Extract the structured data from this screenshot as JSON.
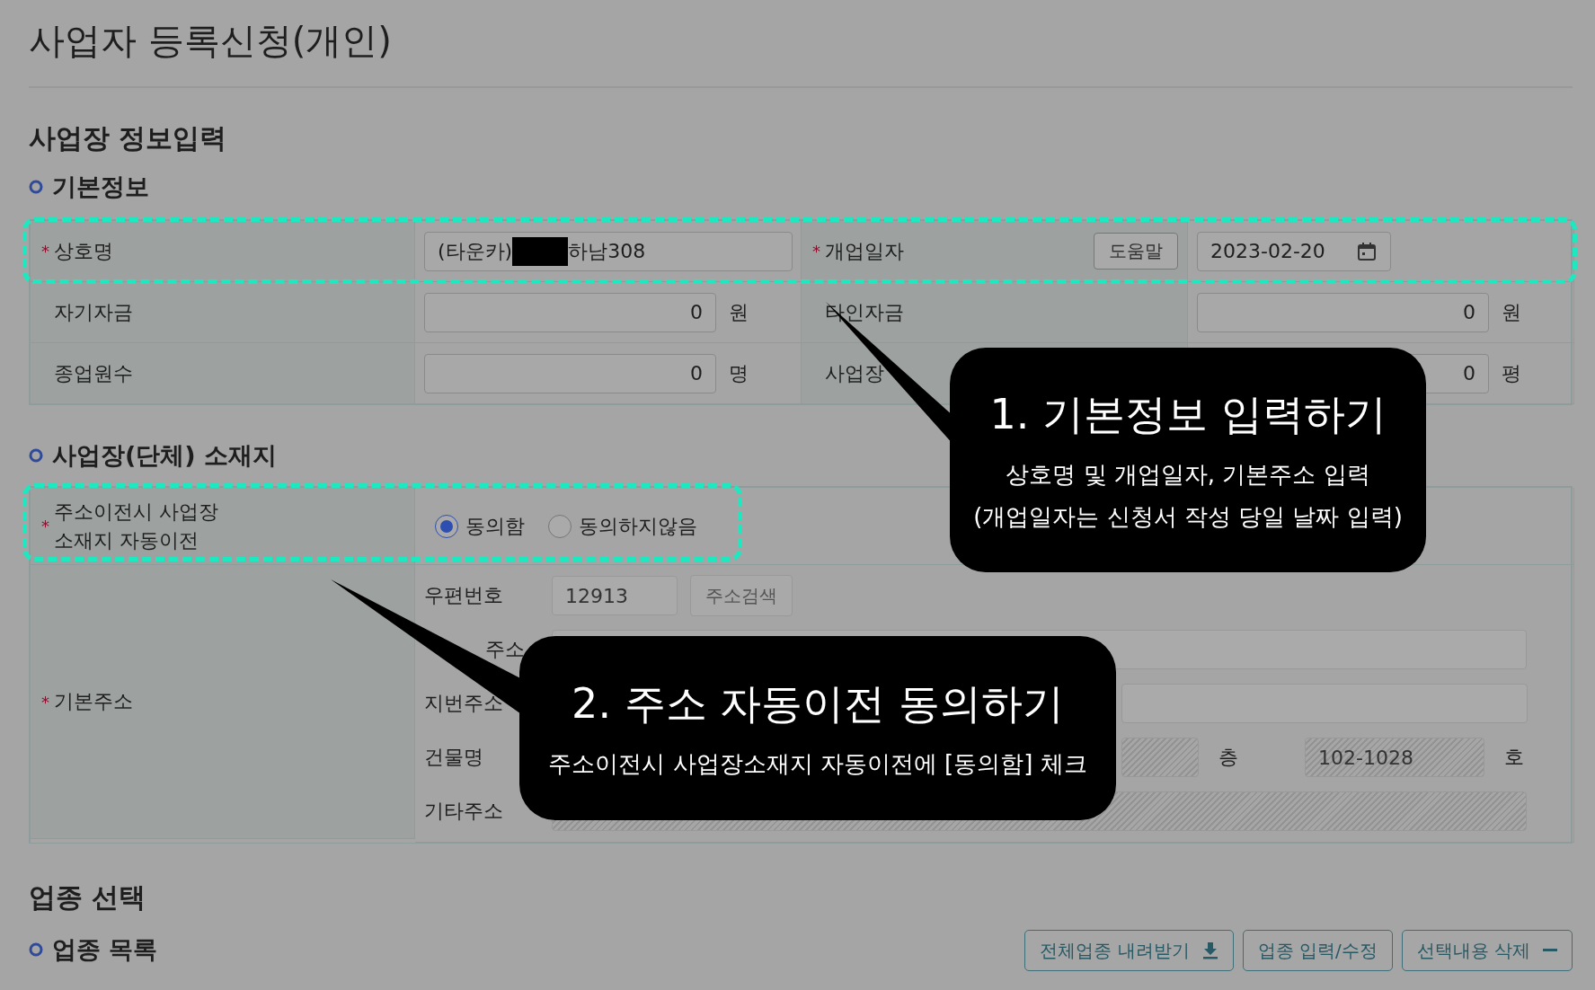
{
  "page_title": "사업자 등록신청(개인)",
  "section_title": "사업장 정보입력",
  "required_mark": "*",
  "basic_info": {
    "heading": "기본정보",
    "business_name": {
      "label": "상호명",
      "required": true,
      "value_parts": [
        "(타운카)",
        "하남308"
      ],
      "redacted": true
    },
    "opening_date": {
      "label": "개업일자",
      "required": true,
      "help_button": "도움말",
      "value": "2023-02-20"
    },
    "own_funds": {
      "label": "자기자금",
      "required": false,
      "value": "0",
      "unit": "원"
    },
    "other_funds": {
      "label": "타인자금",
      "required": false,
      "value": "0",
      "unit": "원"
    },
    "employees": {
      "label": "종업원수",
      "required": false,
      "value": "0",
      "unit": "명"
    },
    "area": {
      "label": "사업장",
      "required": false,
      "value": "0",
      "unit": "평"
    }
  },
  "location": {
    "heading": "사업장(단체) 소재지",
    "auto_transfer": {
      "label_lines": [
        "주소이전시 사업장",
        "소재지 자동이전"
      ],
      "required": true,
      "options": [
        {
          "label": "동의함",
          "selected": true
        },
        {
          "label": "동의하지않음",
          "selected": false
        }
      ]
    },
    "address": {
      "label": "기본주소",
      "required": true,
      "rows": [
        {
          "kind": "postal",
          "label": "우편번호",
          "value": "12913",
          "button": "주소검색"
        },
        {
          "kind": "road",
          "label": "주소",
          "disabled": false
        },
        {
          "kind": "full",
          "label": "지번주소",
          "disabled": false
        },
        {
          "kind": "building",
          "label": "건물명",
          "floor_unit": "층",
          "room_value": "102-1028",
          "room_unit": "호"
        },
        {
          "kind": "full",
          "label": "기타주소",
          "disabled": true
        }
      ]
    }
  },
  "industry": {
    "title": "업종 선택",
    "list_heading": "업종 목록",
    "buttons": [
      {
        "label": "전체업종 내려받기",
        "kind": "download"
      },
      {
        "label": "업종 입력/수정",
        "kind": "plain"
      },
      {
        "label": "선택내용 삭제",
        "kind": "minus"
      }
    ]
  },
  "callouts": [
    {
      "title": "1. 기본정보 입력하기",
      "lines": [
        "상호명 및 개업일자, 기본주소 입력",
        "(개업일자는 신청서 작성 당일 날짜 입력)"
      ]
    },
    {
      "title": "2. 주소 자동이전 동의하기",
      "lines": [
        "주소이전시 사업장소재지 자동이전에 [동의함] 체크"
      ]
    }
  ]
}
